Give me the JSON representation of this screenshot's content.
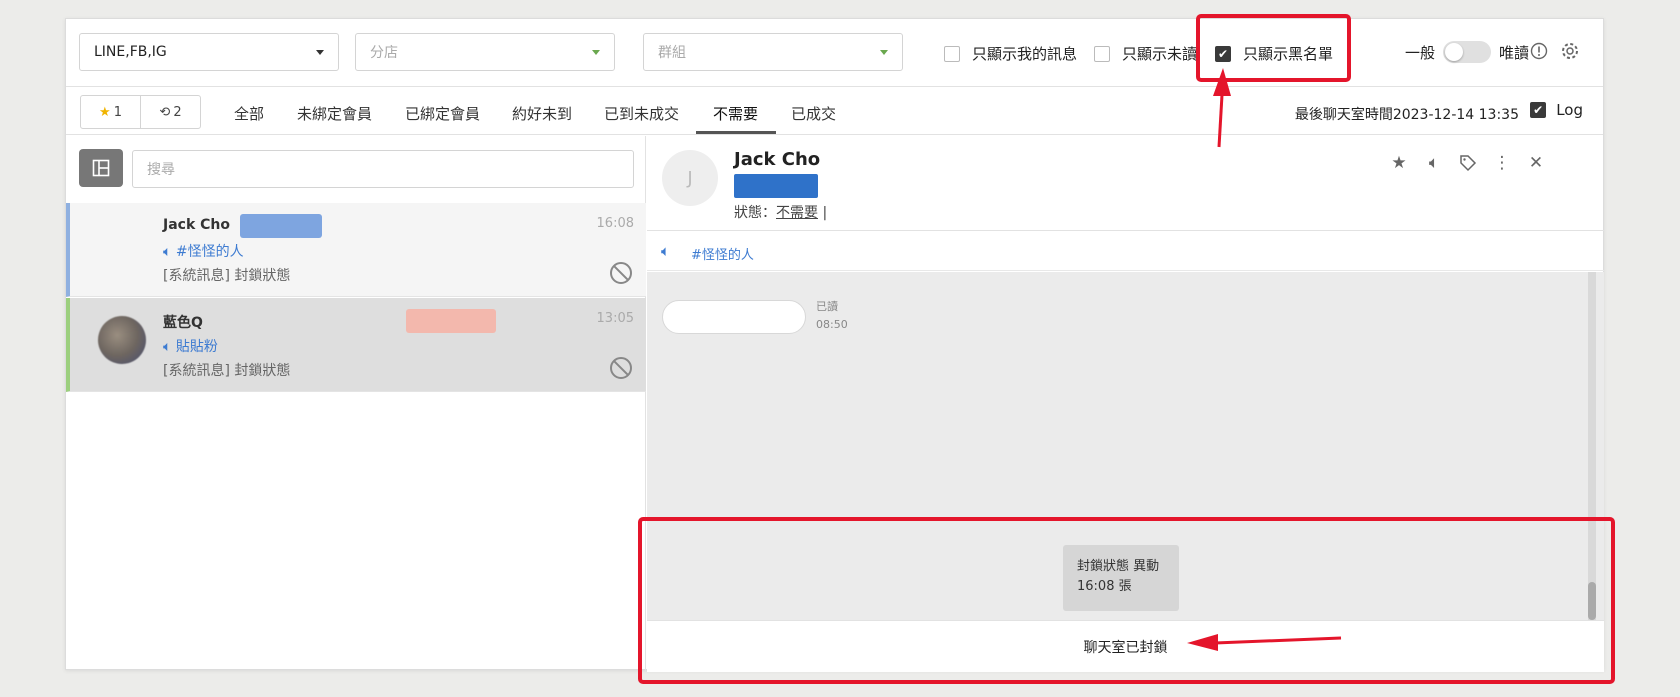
{
  "filters": {
    "channel_select": "LINE,FB,IG",
    "store_placeholder": "分店",
    "group_placeholder": "群組",
    "only_mine": "只顯示我的訊息",
    "only_unread": "只顯示未讀",
    "only_blacklist": "只顯示黑名單",
    "toggle_left": "一般",
    "toggle_right": "唯讀"
  },
  "tabs": {
    "starred_count": "1",
    "history_count": "2",
    "items": [
      "全部",
      "未綁定會員",
      "已綁定會員",
      "約好未到",
      "已到未成交",
      "不需要",
      "已成交"
    ],
    "active": "不需要",
    "last_chat": "最後聊天室時間2023-12-14 13:35",
    "log_label": "Log"
  },
  "search": {
    "placeholder": "搜尋"
  },
  "conversations": [
    {
      "name": "Jack Cho",
      "tag": "#怪怪的人",
      "message": "[系統訊息] 封鎖狀態",
      "time": "16:08"
    },
    {
      "name": "藍色Q",
      "tag": "貼貼粉",
      "message": "[系統訊息] 封鎖狀態",
      "time": "13:05"
    }
  ],
  "chat": {
    "avatar_initial": "J",
    "contact_name": "Jack Cho",
    "status_label": "狀態：",
    "status_value": "不需要",
    "tag": "#怪怪的人",
    "read_label": "已讀",
    "read_time": "08:50",
    "system_line1": "封鎖狀態 異動",
    "system_line2": "16:08 張",
    "locked_text": "聊天室已封鎖"
  },
  "colors": {
    "annotation": "#e4152b",
    "accent_blue": "#3d7bd1"
  }
}
